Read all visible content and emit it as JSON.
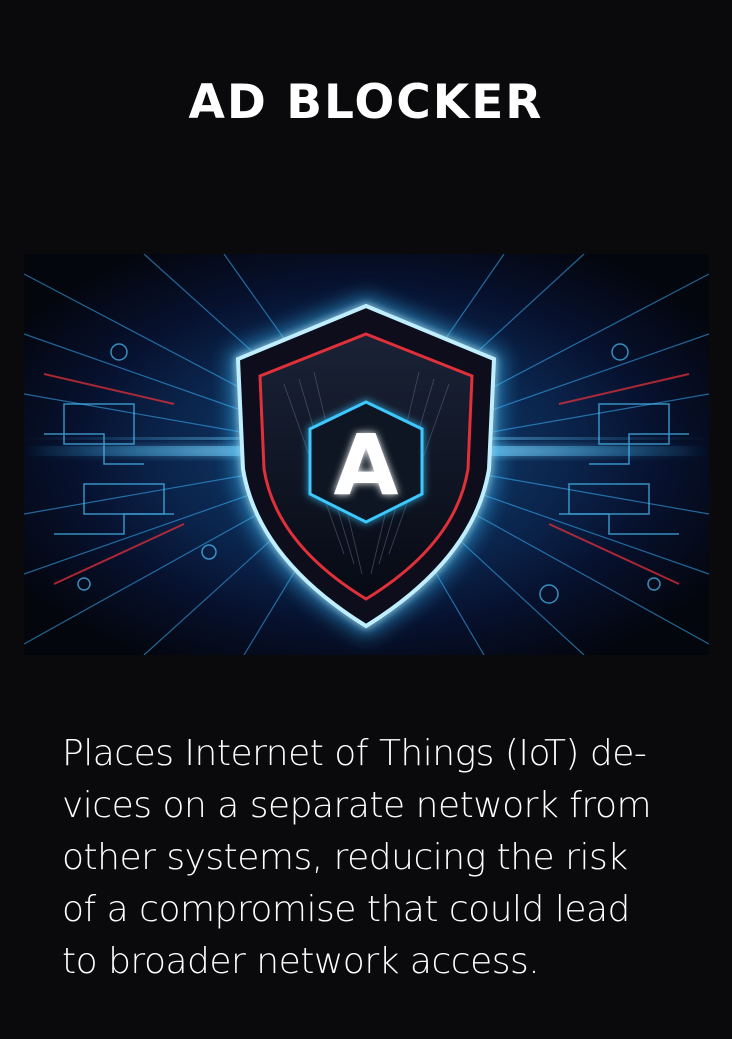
{
  "header": {
    "title": "AD BLOCKER"
  },
  "hero": {
    "shield_letter": "A",
    "icon": "shield-icon",
    "colors": {
      "glow": "#2fb6ff",
      "accent_red": "#e0303a",
      "shield_dark": "#0b0f1c",
      "letter": "#ffffff"
    }
  },
  "description": {
    "lines": [
      "Places Internet of Things (IoT) de-",
      "vices on a separate network from",
      "other systems, reducing the risk",
      "of a compromise that could lead",
      "to broader network access."
    ]
  },
  "theme": {
    "background": "#0a0a0c",
    "text": "#ffffff"
  }
}
